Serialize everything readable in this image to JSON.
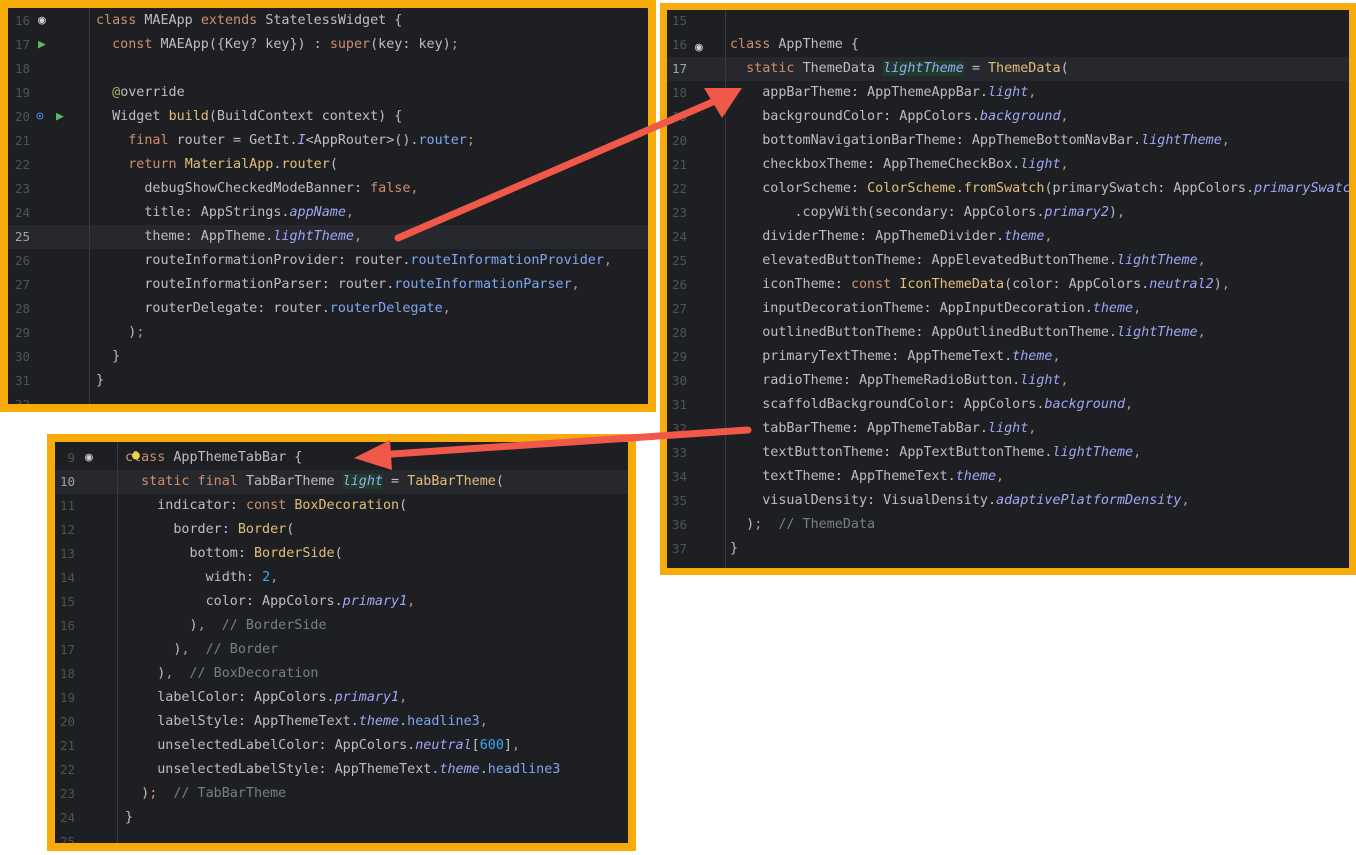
{
  "colors": {
    "frame": "#f7ab0a",
    "editor_bg": "#1e1f22",
    "arrow": "#f0584a"
  },
  "panels": [
    {
      "name": "main-app-snippet",
      "start": 16,
      "current": 25,
      "lines": [
        [
          [
            "k",
            "class "
          ],
          [
            "p",
            "MAEApp "
          ],
          [
            "k",
            "extends "
          ],
          [
            "p",
            "StatelessWidget {"
          ]
        ],
        [
          [
            "p",
            "  "
          ],
          [
            "k",
            "const "
          ],
          [
            "p",
            "MAEApp({Key? key}) : "
          ],
          [
            "k",
            "super"
          ],
          [
            "p",
            "(key: key)"
          ],
          [
            "k",
            ";"
          ]
        ],
        [],
        [
          [
            "p",
            "  "
          ],
          [
            "a",
            "@"
          ],
          [
            "p",
            "override"
          ]
        ],
        [
          [
            "p",
            "  Widget "
          ],
          [
            "c",
            "build"
          ],
          [
            "p",
            "(BuildContext context) {"
          ]
        ],
        [
          [
            "p",
            "    "
          ],
          [
            "k",
            "final "
          ],
          [
            "p",
            "router = GetIt."
          ],
          [
            "f",
            "I"
          ],
          [
            "p",
            "<AppRouter>()."
          ],
          [
            "m",
            "router"
          ],
          [
            "k",
            ";"
          ]
        ],
        [
          [
            "p",
            "    "
          ],
          [
            "k",
            "return "
          ],
          [
            "c",
            "MaterialApp"
          ],
          [
            "p",
            "."
          ],
          [
            "c",
            "router"
          ],
          [
            "p",
            "("
          ]
        ],
        [
          [
            "p",
            "      debugShowCheckedModeBanner: "
          ],
          [
            "k",
            "false,"
          ]
        ],
        [
          [
            "p",
            "      title: AppStrings."
          ],
          [
            "f",
            "appName"
          ],
          [
            "k",
            ","
          ]
        ],
        [
          [
            "p",
            "      theme: AppTheme."
          ],
          [
            "f",
            "lightTheme"
          ],
          [
            "k",
            ","
          ]
        ],
        [
          [
            "p",
            "      routeInformationProvider: router."
          ],
          [
            "m",
            "routeInformationProvider"
          ],
          [
            "k",
            ","
          ]
        ],
        [
          [
            "p",
            "      routeInformationParser: router."
          ],
          [
            "m",
            "routeInformationParser"
          ],
          [
            "k",
            ","
          ]
        ],
        [
          [
            "p",
            "      routerDelegate: router."
          ],
          [
            "m",
            "routerDelegate"
          ],
          [
            "k",
            ","
          ]
        ],
        [
          [
            "p",
            "    )"
          ],
          [
            "k",
            ";"
          ]
        ],
        [
          [
            "p",
            "  }"
          ]
        ],
        [
          [
            "p",
            "}"
          ]
        ],
        []
      ]
    },
    {
      "name": "app-theme-snippet",
      "start": 15,
      "current": 17,
      "lines": [
        [],
        [
          [
            "k",
            "class "
          ],
          [
            "p",
            "AppTheme {"
          ]
        ],
        [
          [
            "p",
            "  "
          ],
          [
            "k",
            "static "
          ],
          [
            "p",
            "ThemeData "
          ],
          [
            "f",
            "lightTheme",
            "hl"
          ],
          [
            "p",
            " = "
          ],
          [
            "c",
            "ThemeData"
          ],
          [
            "p",
            "("
          ]
        ],
        [
          [
            "p",
            "    appBarTheme: AppThemeAppBar."
          ],
          [
            "f",
            "light"
          ],
          [
            "k",
            ","
          ]
        ],
        [
          [
            "p",
            "    backgroundColor: AppColors."
          ],
          [
            "f",
            "background"
          ],
          [
            "k",
            ","
          ]
        ],
        [
          [
            "p",
            "    bottomNavigationBarTheme: AppThemeBottomNavBar."
          ],
          [
            "f",
            "lightTheme"
          ],
          [
            "k",
            ","
          ]
        ],
        [
          [
            "p",
            "    checkboxTheme: AppThemeCheckBox."
          ],
          [
            "f",
            "light"
          ],
          [
            "k",
            ","
          ]
        ],
        [
          [
            "p",
            "    colorScheme: "
          ],
          [
            "c",
            "ColorScheme.fromSwatch"
          ],
          [
            "p",
            "(primarySwatch: AppColors."
          ],
          [
            "f",
            "primarySwatch"
          ],
          [
            "p",
            ")"
          ]
        ],
        [
          [
            "p",
            "        .copyWith(secondary: AppColors."
          ],
          [
            "f",
            "primary2"
          ],
          [
            "p",
            ")"
          ],
          [
            "k",
            ","
          ]
        ],
        [
          [
            "p",
            "    dividerTheme: AppThemeDivider."
          ],
          [
            "f",
            "theme"
          ],
          [
            "k",
            ","
          ]
        ],
        [
          [
            "p",
            "    elevatedButtonTheme: AppElevatedButtonTheme."
          ],
          [
            "f",
            "lightTheme"
          ],
          [
            "k",
            ","
          ]
        ],
        [
          [
            "p",
            "    iconTheme: "
          ],
          [
            "k",
            "const "
          ],
          [
            "c",
            "IconThemeData"
          ],
          [
            "p",
            "(color: AppColors."
          ],
          [
            "f",
            "neutral2"
          ],
          [
            "p",
            ")"
          ],
          [
            "k",
            ","
          ]
        ],
        [
          [
            "p",
            "    inputDecorationTheme: AppInputDecoration."
          ],
          [
            "f",
            "theme"
          ],
          [
            "k",
            ","
          ]
        ],
        [
          [
            "p",
            "    outlinedButtonTheme: AppOutlinedButtonTheme."
          ],
          [
            "f",
            "lightTheme"
          ],
          [
            "k",
            ","
          ]
        ],
        [
          [
            "p",
            "    primaryTextTheme: AppThemeText."
          ],
          [
            "f",
            "theme"
          ],
          [
            "k",
            ","
          ]
        ],
        [
          [
            "p",
            "    radioTheme: AppThemeRadioButton."
          ],
          [
            "f",
            "light"
          ],
          [
            "k",
            ","
          ]
        ],
        [
          [
            "p",
            "    scaffoldBackgroundColor: AppColors."
          ],
          [
            "f",
            "background"
          ],
          [
            "k",
            ","
          ]
        ],
        [
          [
            "p",
            "    tabBarTheme: AppThemeTabBar."
          ],
          [
            "f",
            "light"
          ],
          [
            "k",
            ","
          ]
        ],
        [
          [
            "p",
            "    textButtonTheme: AppTextButtonTheme."
          ],
          [
            "f",
            "lightTheme"
          ],
          [
            "k",
            ","
          ]
        ],
        [
          [
            "p",
            "    textTheme: AppThemeText."
          ],
          [
            "f",
            "theme"
          ],
          [
            "k",
            ","
          ]
        ],
        [
          [
            "p",
            "    visualDensity: VisualDensity."
          ],
          [
            "f",
            "adaptivePlatformDensity"
          ],
          [
            "k",
            ","
          ]
        ],
        [
          [
            "p",
            "  )"
          ],
          [
            "k",
            ";"
          ],
          [
            "cm",
            "  // ThemeData"
          ]
        ],
        [
          [
            "p",
            "}"
          ]
        ]
      ]
    },
    {
      "name": "tab-bar-theme-snippet",
      "start": 9,
      "current": 10,
      "lines": [
        [
          [
            "k",
            "class "
          ],
          [
            "p",
            "AppThemeTabBar {"
          ]
        ],
        [
          [
            "p",
            "  "
          ],
          [
            "k",
            "static final "
          ],
          [
            "p",
            "TabBarTheme "
          ],
          [
            "f",
            "light",
            "hl"
          ],
          [
            "p",
            " = "
          ],
          [
            "c",
            "TabBarTheme"
          ],
          [
            "p",
            "("
          ]
        ],
        [
          [
            "p",
            "    indicator: "
          ],
          [
            "k",
            "const "
          ],
          [
            "c",
            "BoxDecoration"
          ],
          [
            "p",
            "("
          ]
        ],
        [
          [
            "p",
            "      border: "
          ],
          [
            "c",
            "Border"
          ],
          [
            "p",
            "("
          ]
        ],
        [
          [
            "p",
            "        bottom: "
          ],
          [
            "c",
            "BorderSide"
          ],
          [
            "p",
            "("
          ]
        ],
        [
          [
            "p",
            "          width: "
          ],
          [
            "n",
            "2"
          ],
          [
            "k",
            ","
          ]
        ],
        [
          [
            "p",
            "          color: AppColors."
          ],
          [
            "f",
            "primary1"
          ],
          [
            "k",
            ","
          ]
        ],
        [
          [
            "p",
            "        )"
          ],
          [
            "k",
            ","
          ],
          [
            "cm",
            "  // BorderSide"
          ]
        ],
        [
          [
            "p",
            "      )"
          ],
          [
            "k",
            ","
          ],
          [
            "cm",
            "  // Border"
          ]
        ],
        [
          [
            "p",
            "    )"
          ],
          [
            "k",
            ","
          ],
          [
            "cm",
            "  // BoxDecoration"
          ]
        ],
        [
          [
            "p",
            "    labelColor: AppColors."
          ],
          [
            "f",
            "primary1"
          ],
          [
            "k",
            ","
          ]
        ],
        [
          [
            "p",
            "    labelStyle: AppThemeText."
          ],
          [
            "f",
            "theme"
          ],
          [
            "p",
            "."
          ],
          [
            "m",
            "headline3"
          ],
          [
            "k",
            ","
          ]
        ],
        [
          [
            "p",
            "    unselectedLabelColor: AppColors."
          ],
          [
            "f",
            "neutral"
          ],
          [
            "p",
            "["
          ],
          [
            "n",
            "600"
          ],
          [
            "p",
            "]"
          ],
          [
            "k",
            ","
          ]
        ],
        [
          [
            "p",
            "    unselectedLabelStyle: AppThemeText."
          ],
          [
            "f",
            "theme"
          ],
          [
            "p",
            "."
          ],
          [
            "m",
            "headline3"
          ]
        ],
        [
          [
            "p",
            "  )"
          ],
          [
            "k",
            ";"
          ],
          [
            "cm",
            "  // TabBarTheme"
          ]
        ],
        [
          [
            "p",
            "}"
          ]
        ],
        []
      ]
    }
  ],
  "gutter_icons": [
    "eye-icon",
    "override-run-icon",
    "implements-override-icon",
    "bulb-icon"
  ]
}
